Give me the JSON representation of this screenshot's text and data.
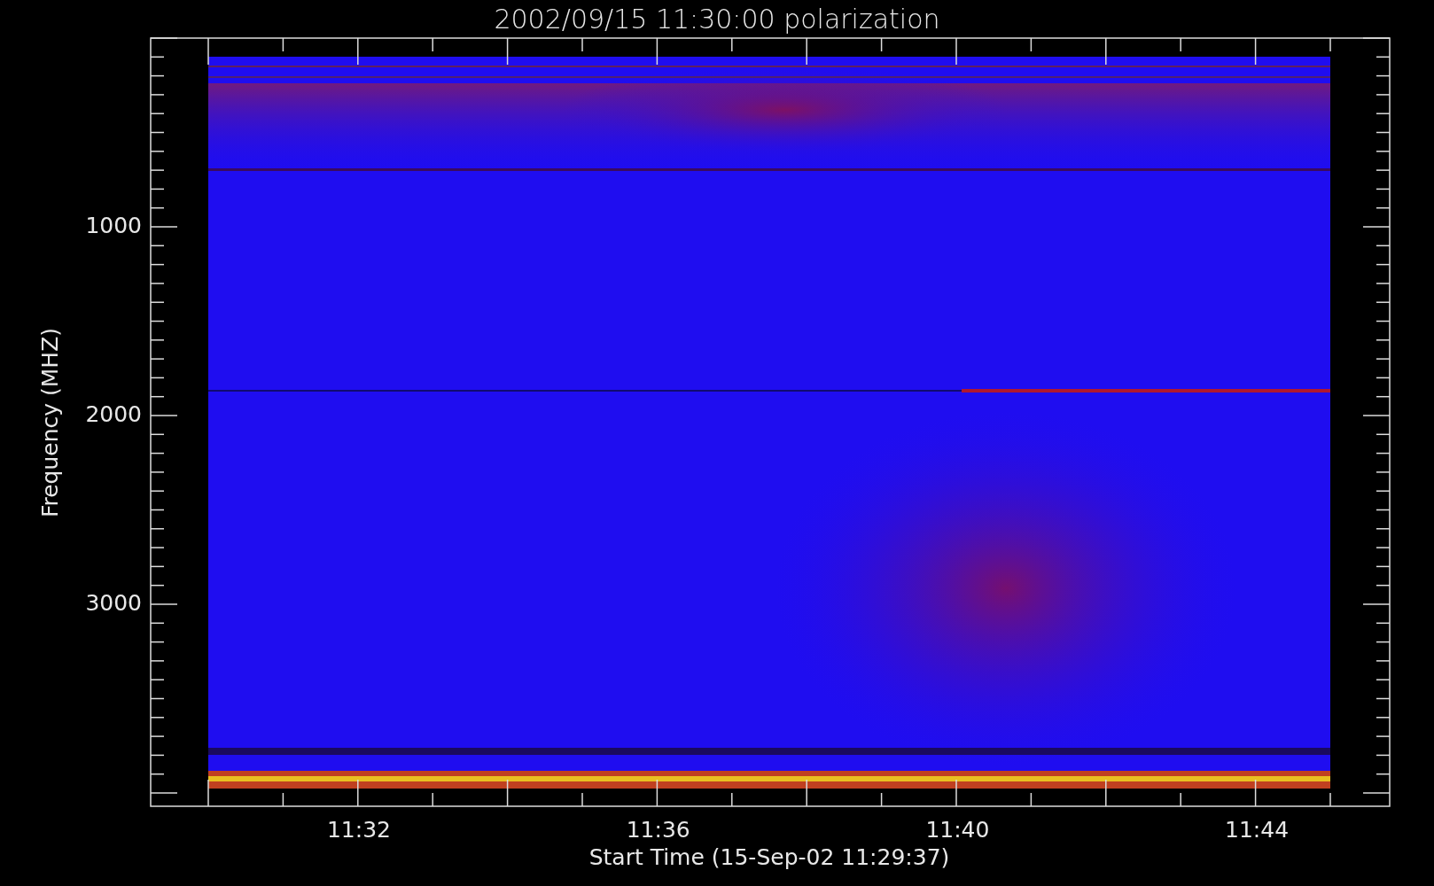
{
  "title": "2002/09/15 11:30:00 polarization",
  "y_axis": {
    "label": "Frequency (MHZ)",
    "ticks": [
      "1000",
      "2000",
      "3000"
    ]
  },
  "x_axis": {
    "label": "Start Time (15-Sep-02 11:29:37)",
    "ticks": [
      "11:32",
      "11:36",
      "11:40",
      "11:44"
    ]
  }
}
